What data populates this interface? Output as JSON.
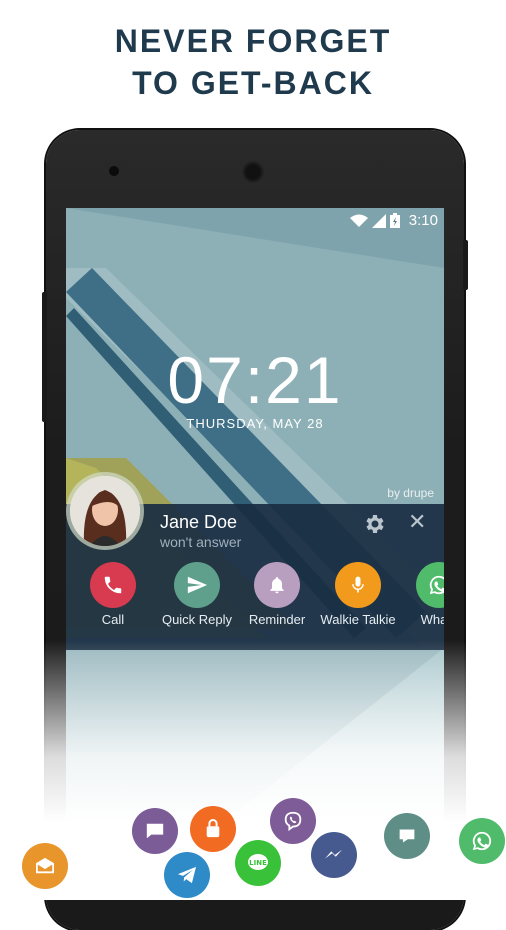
{
  "headline": {
    "line1": "NEVER FORGET",
    "line2": "TO GET-BACK"
  },
  "status_bar": {
    "time": "3:10"
  },
  "lockscreen": {
    "clock": "07:21",
    "date": "THURSDAY, MAY 28",
    "watermark": "by drupe"
  },
  "contact_panel": {
    "name": "Jane Doe",
    "status": "won't answer",
    "actions": [
      {
        "label": "Call",
        "icon": "phone-icon",
        "color": "#d83b4f"
      },
      {
        "label": "Quick Reply",
        "icon": "send-icon",
        "color": "#5ea08c"
      },
      {
        "label": "Reminder",
        "icon": "bell-icon",
        "color": "#b89fc0"
      },
      {
        "label": "Walkie Talkie",
        "icon": "microphone-icon",
        "color": "#f29a1c"
      },
      {
        "label": "Whats",
        "icon": "whatsapp-icon",
        "color": "#4fbb6b"
      }
    ]
  },
  "dock_apps": [
    {
      "name": "email-icon",
      "color": "#e8952c"
    },
    {
      "name": "messaging-icon",
      "color": "#7b5c97"
    },
    {
      "name": "telegram-icon",
      "color": "#2f8bc8"
    },
    {
      "name": "sms-lock-icon",
      "color": "#f26b22"
    },
    {
      "name": "line-icon",
      "color": "#39c13a"
    },
    {
      "name": "viber-icon",
      "color": "#7d5c97"
    },
    {
      "name": "messenger-icon",
      "color": "#465a8f"
    },
    {
      "name": "hangouts-chat-icon",
      "color": "#5e8e86"
    },
    {
      "name": "whatsapp-icon",
      "color": "#4fbb6b"
    }
  ]
}
